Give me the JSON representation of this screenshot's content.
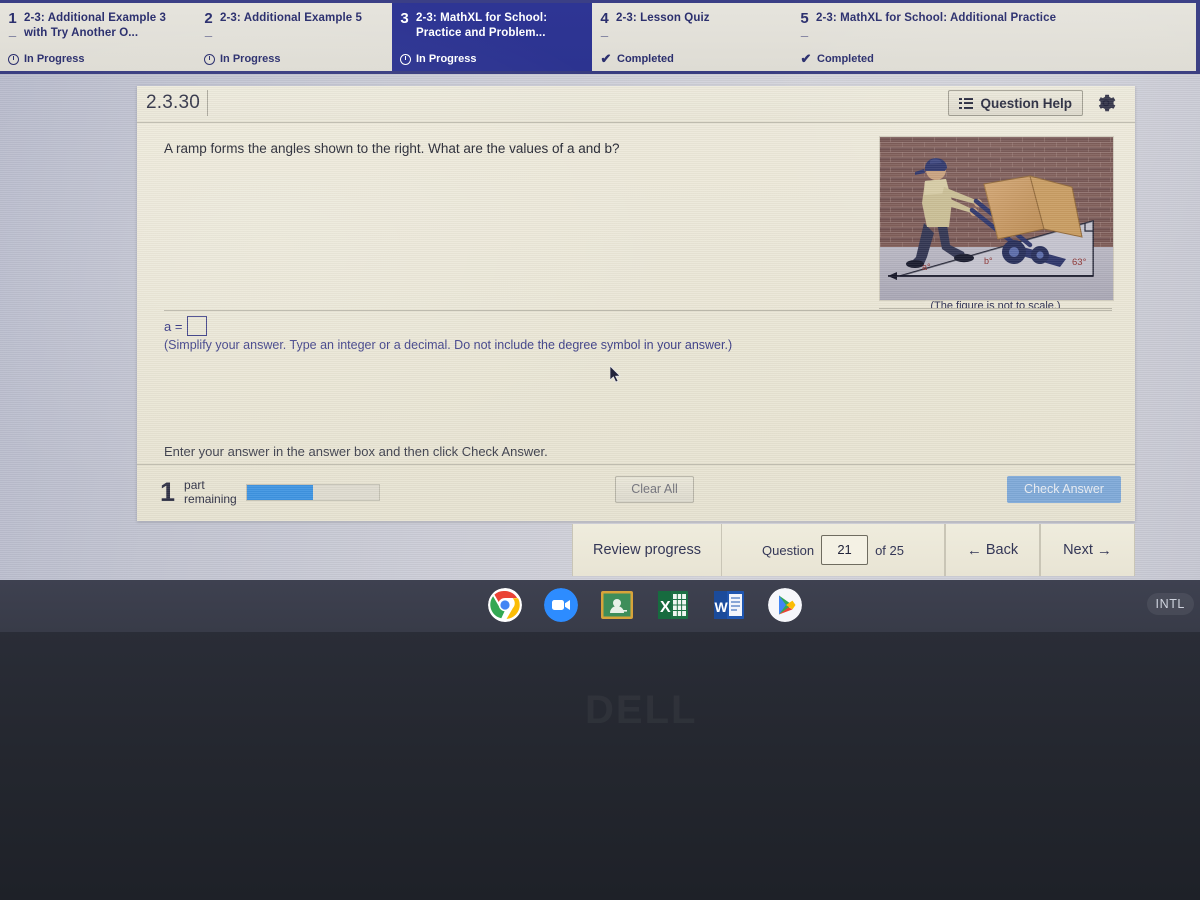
{
  "assignment_tabs": [
    {
      "num": "1",
      "title": "2-3: Additional Example 3 with Try Another O...",
      "status": "In Progress",
      "status_icon": "clock-icon",
      "active": false
    },
    {
      "num": "2",
      "title": "2-3: Additional Example 5",
      "status": "In Progress",
      "status_icon": "clock-icon",
      "active": false
    },
    {
      "num": "3",
      "title": "2-3: MathXL for School: Practice and Problem...",
      "status": "In Progress",
      "status_icon": "clock-icon",
      "active": true
    },
    {
      "num": "4",
      "title": "2-3: Lesson Quiz",
      "status": "Completed",
      "status_icon": "check-icon",
      "active": false
    },
    {
      "num": "5",
      "title": "2-3: MathXL for School: Additional Practice",
      "status": "Completed",
      "status_icon": "check-icon",
      "active": false
    }
  ],
  "exercise": {
    "number": "2.3.30",
    "question_help_label": "Question Help",
    "gear_icon": "gear-icon",
    "question_text": "A ramp forms the angles shown to the right. What are the values of a and b?",
    "answer_prefix": "a =",
    "answer_value": "",
    "answer_hint": "(Simplify your answer. Type an integer or a decimal. Do not include the degree symbol in your answer.)",
    "instruction": "Enter your answer in the answer box and then click Check Answer.",
    "parts_remaining_number": "1",
    "parts_remaining_label_line1": "part",
    "parts_remaining_label_line2": "remaining",
    "progress_percent": 50,
    "clear_all_label": "Clear All",
    "check_answer_label": "Check Answer"
  },
  "figure": {
    "caption": "(The figure is not to scale.)",
    "angle_a": "a°",
    "angle_b": "b°",
    "angle_known": "63°",
    "description": "Man pushing a hand truck loaded with boxes up a ramp against a brick wall"
  },
  "navigation": {
    "review_progress_label": "Review progress",
    "question_label": "Question",
    "question_number": "21",
    "of_label": "of 25",
    "back_label": "Back",
    "next_label": "Next",
    "back_arrow": "←",
    "next_arrow": "→"
  },
  "shelf": {
    "icons": [
      {
        "name": "chrome-icon"
      },
      {
        "name": "zoom-icon"
      },
      {
        "name": "google-classroom-icon"
      },
      {
        "name": "excel-icon"
      },
      {
        "name": "word-icon"
      },
      {
        "name": "play-store-icon"
      }
    ],
    "status_label": "INTL"
  },
  "device": {
    "brand_logo": "DELL"
  },
  "colors": {
    "tab_active_bg": "#2e3594",
    "top_band": "#3b3f86",
    "progress_fill": "#3d93e2",
    "check_answer_bg": "#7fa9d8",
    "answer_text": "#3b3d86"
  }
}
